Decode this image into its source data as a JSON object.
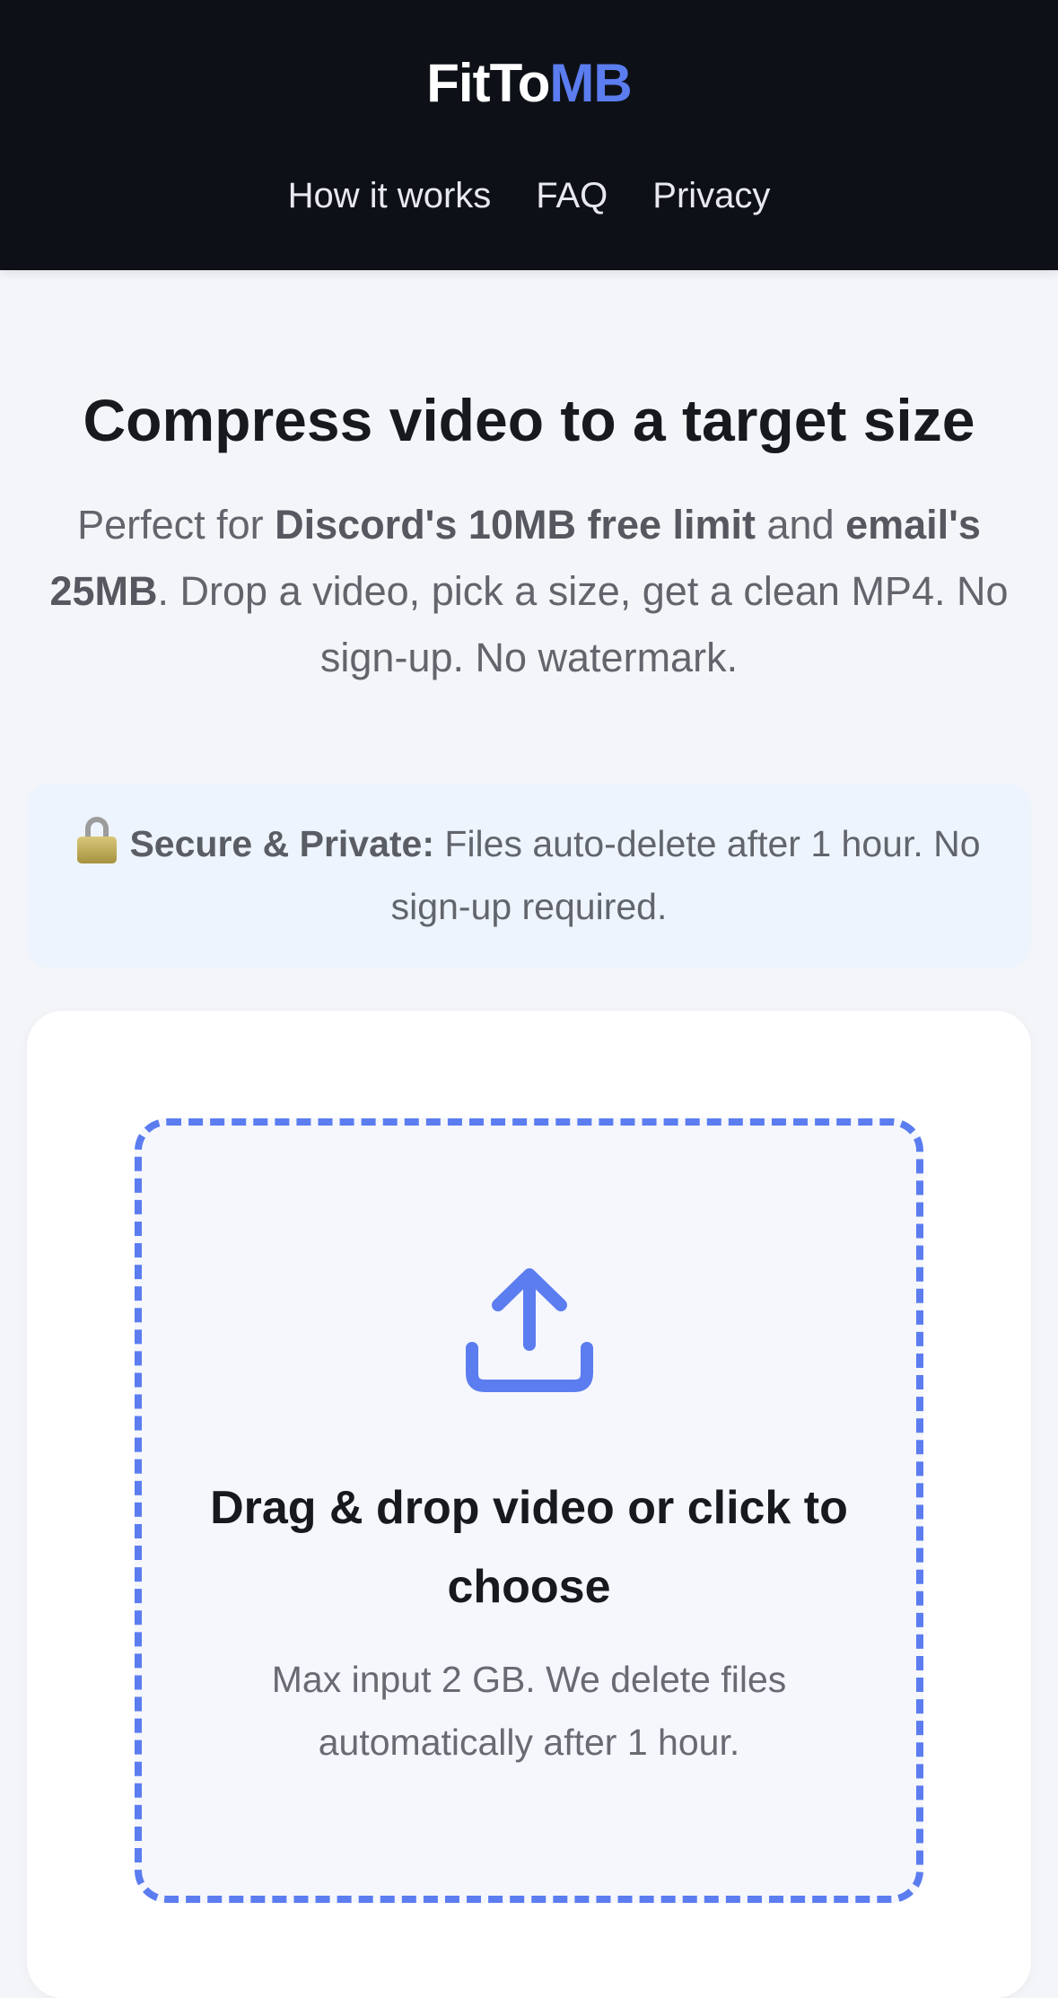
{
  "header": {
    "logo_main": "FitTo",
    "logo_accent": "MB",
    "nav": [
      "How it works",
      "FAQ",
      "Privacy"
    ]
  },
  "hero": {
    "title": "Compress video to a target size",
    "sub_1": "Perfect for ",
    "sub_bold_1": "Discord's 10MB free limit",
    "sub_2": " and ",
    "sub_bold_2": "email's 25MB",
    "sub_3": ". Drop a video, pick a size, get a clean MP4. No sign-up. No watermark."
  },
  "notice": {
    "icon": "lock-icon",
    "bold": "Secure & Private:",
    "text": " Files auto-delete after 1 hour. No sign-up required."
  },
  "dropzone": {
    "icon": "upload-icon",
    "title": "Drag & drop video or click to choose",
    "subtitle": "Max input 2 GB. We delete files automatically after 1 hour."
  },
  "colors": {
    "header_bg": "#0d1117",
    "accent": "#5b7df0",
    "page_bg": "#f4f5f9",
    "notice_bg": "#eef4fd"
  }
}
